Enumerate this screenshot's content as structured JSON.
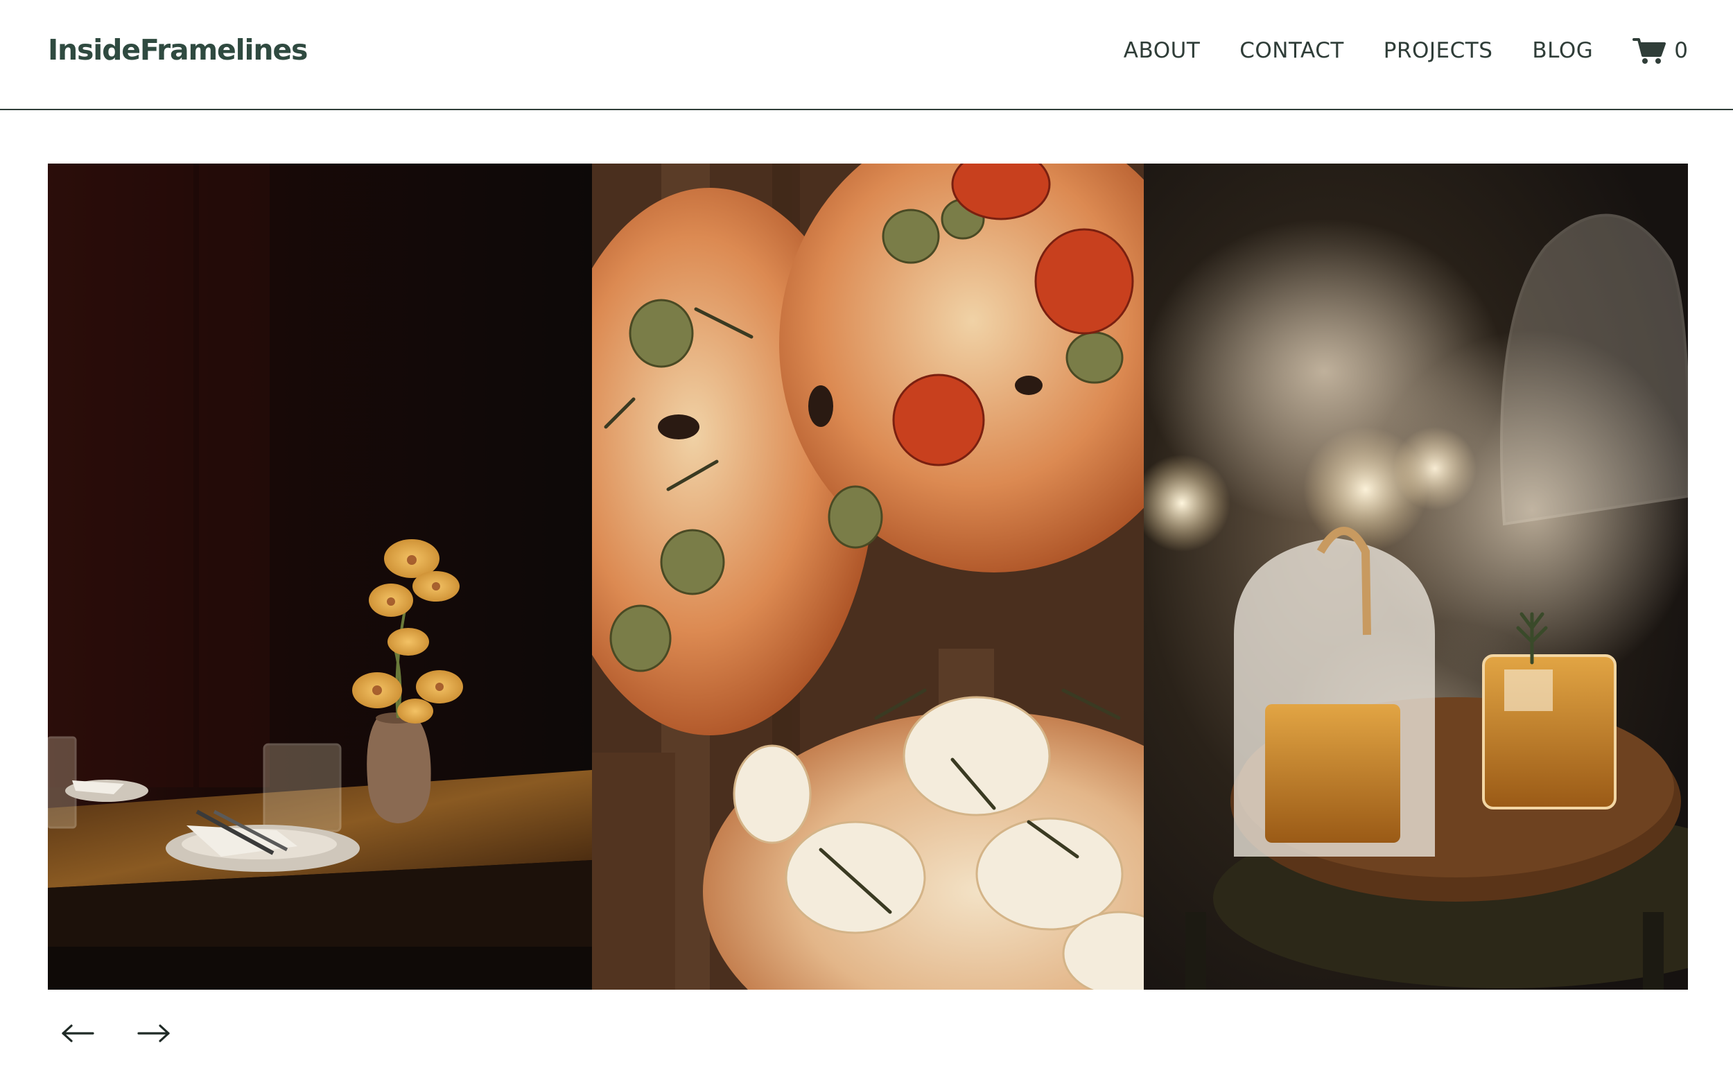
{
  "header": {
    "logo_text": "InsideFramelines",
    "nav": [
      {
        "label": "ABOUT"
      },
      {
        "label": "CONTACT"
      },
      {
        "label": "PROJECTS"
      },
      {
        "label": "BLOG"
      }
    ],
    "cart": {
      "icon": "cart-icon",
      "count": "0"
    }
  },
  "gallery": {
    "images": [
      {
        "subject": "restaurant-table-with-orchid"
      },
      {
        "subject": "focaccia-breads"
      },
      {
        "subject": "smoked-cocktails-under-cloche"
      }
    ],
    "controls": {
      "prev_icon": "arrow-left-icon",
      "next_icon": "arrow-right-icon"
    }
  },
  "colors": {
    "text": "#2f3d38",
    "logo": "#2f4a40",
    "divider": "#2f3d38",
    "background": "#ffffff"
  }
}
